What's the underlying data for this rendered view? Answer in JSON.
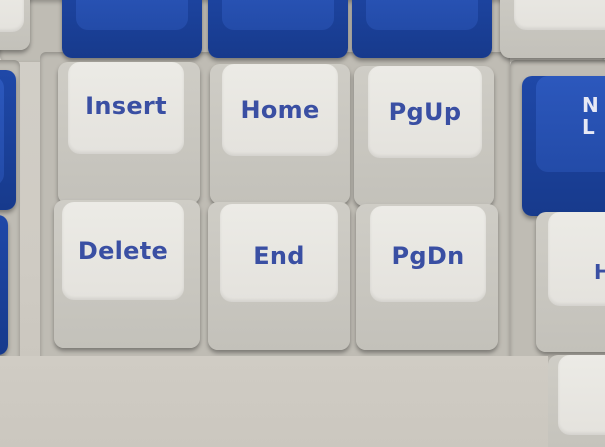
{
  "keys": {
    "insert": "Insert",
    "home": "Home",
    "pgup": "PgUp",
    "delete": "Delete",
    "end": "End",
    "pgdn": "PgDn",
    "right_partial_top": "N\nL",
    "right_partial_bottom": "H"
  },
  "colors": {
    "white_cap": "#e6e4df",
    "blue_cap": "#2450b0",
    "legend": "#3a4fa3",
    "case": "#cfcbc3"
  }
}
